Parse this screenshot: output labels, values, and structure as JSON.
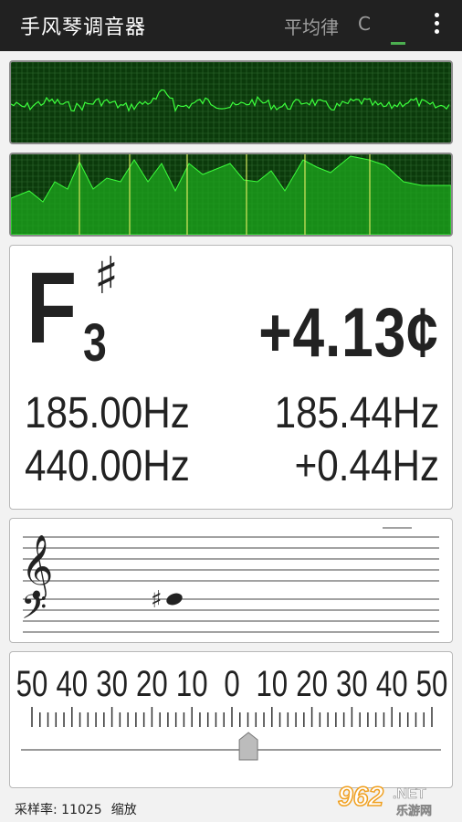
{
  "app": {
    "title": "手风琴调音器",
    "temperament": "平均律",
    "key": "C"
  },
  "tuner": {
    "note": "F",
    "accidental": "♯",
    "octave": "3",
    "cents": "+4.13¢",
    "target_freq": "185.00Hz",
    "measured_freq": "185.44Hz",
    "reference_freq": "440.00Hz",
    "delta_freq": "+0.44Hz"
  },
  "meter": {
    "scale_labels": [
      "50",
      "40",
      "30",
      "20",
      "10",
      "0",
      "10",
      "20",
      "30",
      "40",
      "50"
    ],
    "needle_cents": 4.13
  },
  "status": {
    "sample_rate": "采样率: 11025",
    "zoom_label": "缩放"
  },
  "watermark": {
    "brand": "962.NET",
    "site": "乐游网"
  },
  "colors": {
    "scope_bg": "#0b3a0b",
    "scope_grid": "#2f6b2f",
    "trace": "#3cff3c",
    "spectrum_fill": "#1ea81e",
    "marker": "#d8e860",
    "appbar": "#212121",
    "accent": "#4caf50"
  }
}
